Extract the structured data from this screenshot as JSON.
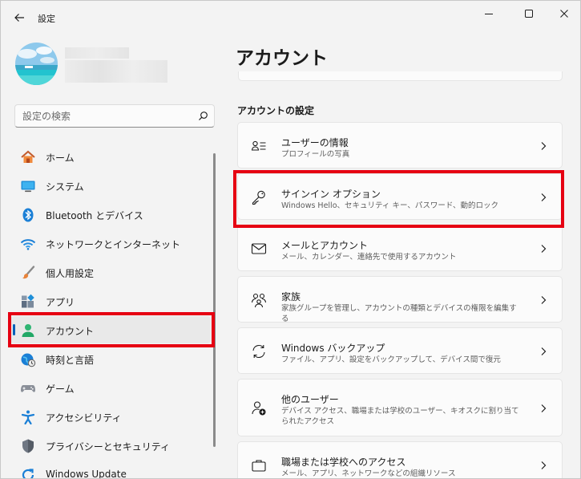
{
  "window": {
    "title": "設定",
    "minimize_icon": "minimize-icon",
    "maximize_icon": "maximize-icon",
    "close_icon": "close-icon"
  },
  "search": {
    "placeholder": "設定の検索"
  },
  "sidebar": {
    "items": [
      {
        "label": "ホーム",
        "icon": "home-icon"
      },
      {
        "label": "システム",
        "icon": "system-icon"
      },
      {
        "label": "Bluetooth とデバイス",
        "icon": "bluetooth-icon"
      },
      {
        "label": "ネットワークとインターネット",
        "icon": "wifi-icon"
      },
      {
        "label": "個人用設定",
        "icon": "brush-icon"
      },
      {
        "label": "アプリ",
        "icon": "apps-icon"
      },
      {
        "label": "アカウント",
        "icon": "account-icon",
        "active": true
      },
      {
        "label": "時刻と言語",
        "icon": "globe-clock-icon"
      },
      {
        "label": "ゲーム",
        "icon": "gamepad-icon"
      },
      {
        "label": "アクセシビリティ",
        "icon": "accessibility-icon"
      },
      {
        "label": "プライバシーとセキュリティ",
        "icon": "shield-icon"
      },
      {
        "label": "Windows Update",
        "icon": "update-icon"
      }
    ]
  },
  "main": {
    "title": "アカウント",
    "section_heading": "アカウントの設定",
    "cards": [
      {
        "title": "ユーザーの情報",
        "desc": "プロフィールの写真",
        "icon": "user-info-icon"
      },
      {
        "title": "サインイン オプション",
        "desc": "Windows Hello、セキュリティ キー、パスワード、動的ロック",
        "icon": "key-icon"
      },
      {
        "title": "メールとアカウント",
        "desc": "メール、カレンダー、連絡先で使用するアカウント",
        "icon": "mail-icon"
      },
      {
        "title": "家族",
        "desc": "家族グループを管理し、アカウントの種類とデバイスの権限を編集する",
        "icon": "family-icon"
      },
      {
        "title": "Windows バックアップ",
        "desc": "ファイル、アプリ、設定をバックアップして、デバイス間で復元",
        "icon": "backup-icon"
      },
      {
        "title": "他のユーザー",
        "desc": "デバイス アクセス、職場または学校のユーザー、キオスクに割り当てられたアクセス",
        "icon": "add-user-icon"
      },
      {
        "title": "職場または学校へのアクセス",
        "desc": "メール、アプリ、ネットワークなどの組織リソース",
        "icon": "briefcase-icon"
      }
    ]
  },
  "colors": {
    "accent": "#005fb8",
    "highlight": "#e60012",
    "background": "#f3f3f3",
    "card": "#fbfbfb"
  }
}
